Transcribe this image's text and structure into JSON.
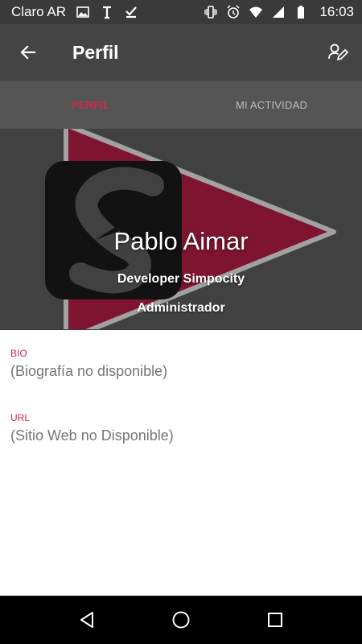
{
  "status_bar": {
    "carrier": "Claro AR",
    "time": "16:03",
    "icons_left": [
      "image-icon",
      "text-icon",
      "check-download-icon"
    ],
    "icons_right": [
      "vibrate-icon",
      "alarm-icon",
      "wifi-icon",
      "signal-icon",
      "battery-icon"
    ]
  },
  "app_bar": {
    "title": "Perfil",
    "back_icon": "arrow-back-icon",
    "edit_icon": "edit-profile-icon"
  },
  "tabs": [
    {
      "label": "PERFIL",
      "active": true
    },
    {
      "label": "MI ACTIVIDAD",
      "active": false
    }
  ],
  "profile": {
    "name": "Pablo Aimar",
    "role": "Developer Simpocity",
    "rank": "Administrador"
  },
  "fields": [
    {
      "label": "BIO",
      "value": "(Biografía no disponible)"
    },
    {
      "label": "URL",
      "value": "(Sitio Web no Disponible)"
    }
  ],
  "colors": {
    "accent": "#d0284f",
    "app_bar": "#444444",
    "tab_bar": "#555555",
    "status_bar": "#3a3a3a",
    "label_gray": "#757575"
  },
  "nav": [
    "back-triangle-icon",
    "home-circle-icon",
    "recents-square-icon"
  ]
}
